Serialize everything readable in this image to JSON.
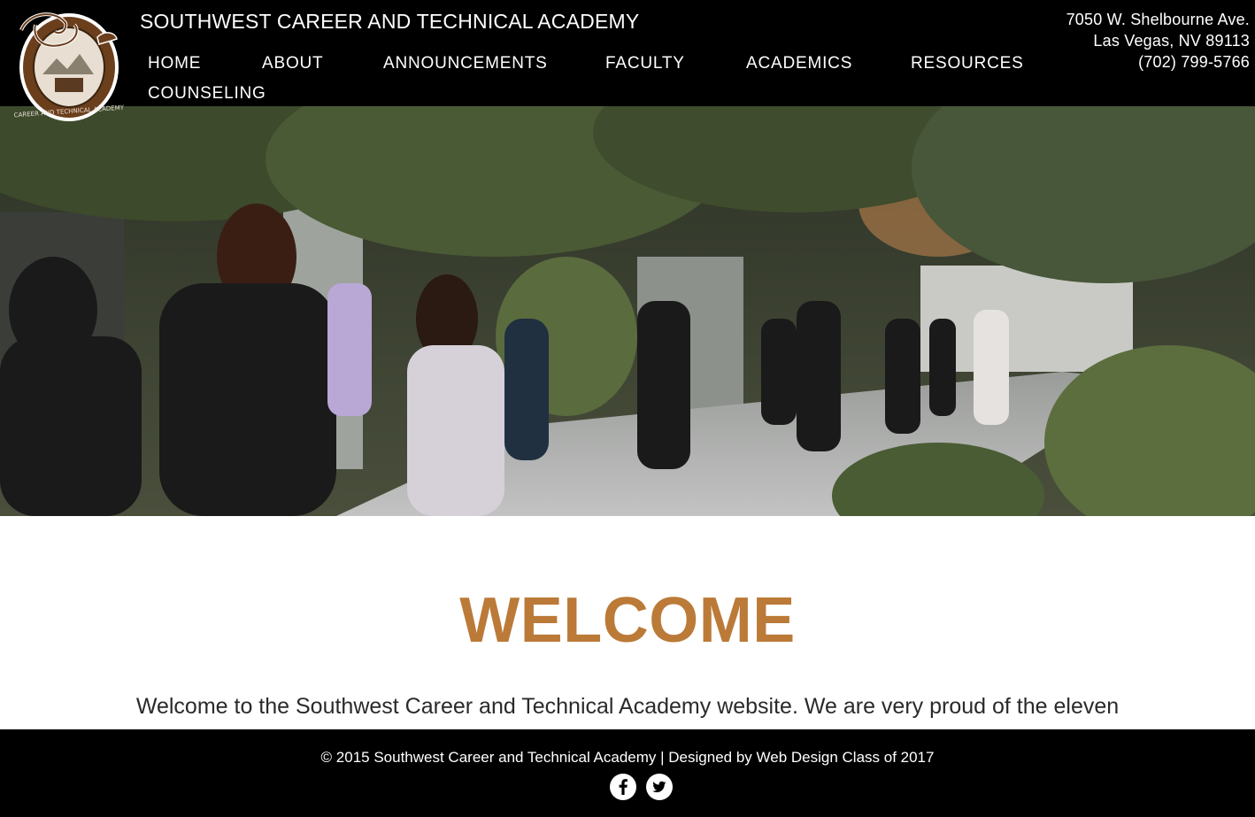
{
  "header": {
    "site_title": "SOUTHWEST CAREER AND TECHNICAL ACADEMY",
    "logo_icon": "school-crest-logo",
    "address_line1": "7050 W. Shelbourne Ave.",
    "address_line2": "Las Vegas, NV 89113",
    "phone": "(702) 799-5766"
  },
  "nav": {
    "items": [
      {
        "label": "HOME"
      },
      {
        "label": "ABOUT"
      },
      {
        "label": "ANNOUNCEMENTS"
      },
      {
        "label": "FACULTY"
      },
      {
        "label": "ACADEMICS"
      },
      {
        "label": "RESOURCES"
      },
      {
        "label": "COUNSELING"
      }
    ]
  },
  "main": {
    "welcome_title": "WELCOME",
    "welcome_text": "Welcome to the Southwest Career and Technical Academy website. We are very proud of the eleven"
  },
  "footer": {
    "copyright": "© 2015 Southwest Career and Technical Academy | Designed by Web Design Class of 2017",
    "social": [
      {
        "icon": "facebook-icon"
      },
      {
        "icon": "twitter-icon"
      }
    ]
  },
  "colors": {
    "header_bg": "#000000",
    "accent": "#bb7a38",
    "footer_bg": "#000000"
  }
}
